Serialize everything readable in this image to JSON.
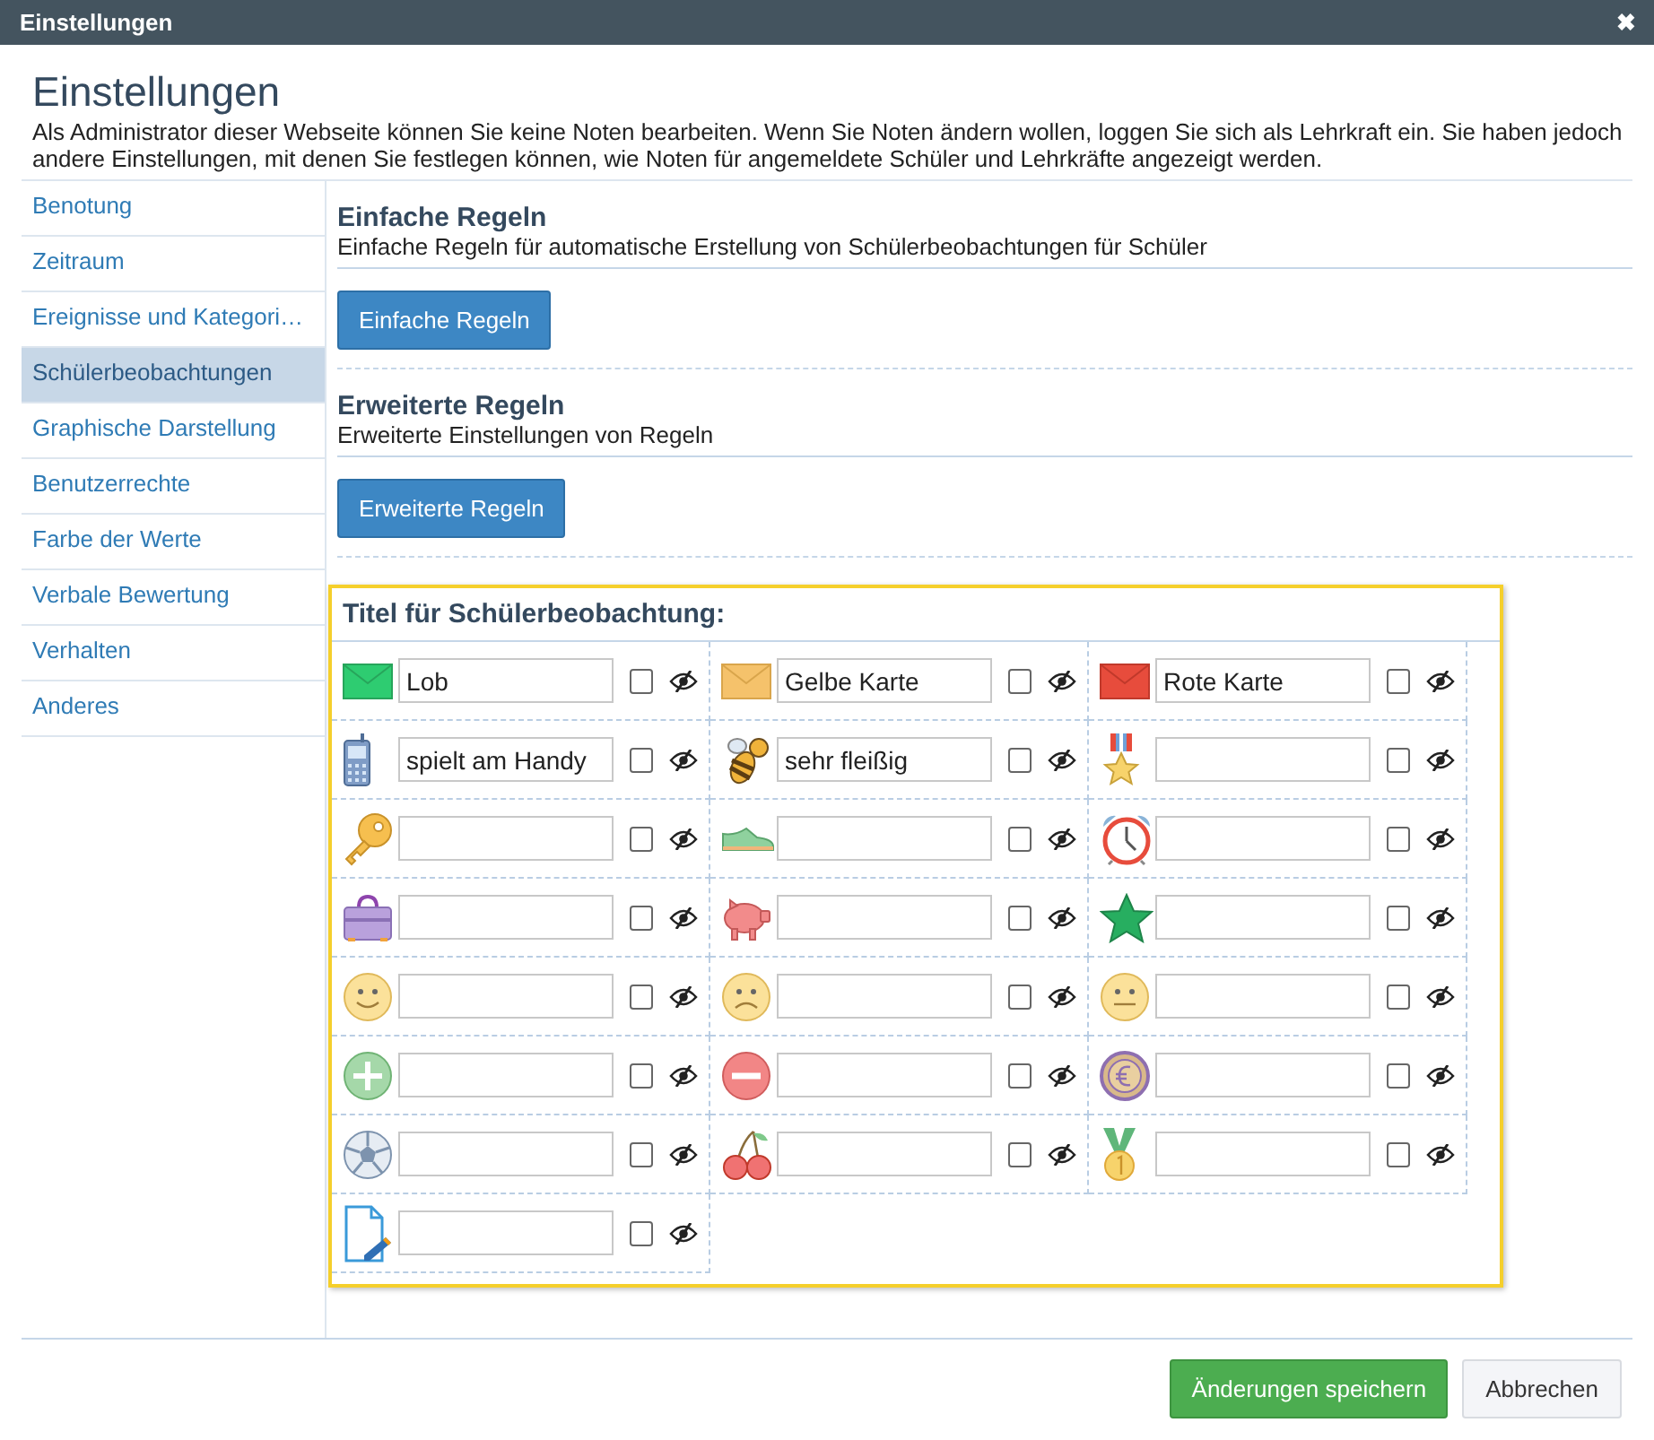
{
  "window": {
    "title": "Einstellungen",
    "close": "✖"
  },
  "header": {
    "title": "Einstellungen",
    "description": "Als Administrator dieser Webseite können Sie keine Noten bearbeiten. Wenn Sie Noten ändern wollen, loggen Sie sich als Lehrkraft ein. Sie haben jedoch andere Einstellungen, mit denen Sie festlegen können, wie Noten für angemeldete Schüler und Lehrkräfte angezeigt werden."
  },
  "sidebar": {
    "items": [
      {
        "label": "Benotung",
        "selected": false
      },
      {
        "label": "Zeitraum",
        "selected": false
      },
      {
        "label": "Ereignisse und Kategori…",
        "selected": false
      },
      {
        "label": "Schülerbeobachtungen",
        "selected": true
      },
      {
        "label": "Graphische Darstellung",
        "selected": false
      },
      {
        "label": "Benutzerrechte",
        "selected": false
      },
      {
        "label": "Farbe der Werte",
        "selected": false
      },
      {
        "label": "Verbale Bewertung",
        "selected": false
      },
      {
        "label": "Verhalten",
        "selected": false
      },
      {
        "label": "Anderes",
        "selected": false
      }
    ]
  },
  "sections": [
    {
      "title": "Einfache Regeln",
      "subtitle": "Einfache Regeln für automatische Erstellung von Schülerbeobachtungen für Schüler",
      "button": "Einfache Regeln"
    },
    {
      "title": "Erweiterte Regeln",
      "subtitle": "Erweiterte Einstellungen von Regeln",
      "button": "Erweiterte Regeln"
    }
  ],
  "observations_title": "Titel für Schülerbeobachtung:",
  "observations": [
    {
      "value": "Lob",
      "checked": false
    },
    {
      "value": "Gelbe Karte",
      "checked": false
    },
    {
      "value": "Rote Karte",
      "checked": false
    },
    {
      "value": "spielt am Handy",
      "checked": false
    },
    {
      "value": "sehr fleißig",
      "checked": false
    },
    {
      "checked": false
    },
    {
      "checked": false
    },
    {
      "checked": false
    },
    {
      "checked": false
    },
    {
      "checked": false
    },
    {
      "checked": false
    },
    {
      "checked": false
    },
    {
      "checked": false
    },
    {
      "checked": false
    },
    {
      "checked": false
    },
    {
      "checked": false
    },
    {
      "checked": false
    },
    {
      "checked": false
    },
    {
      "checked": false
    },
    {
      "checked": false
    },
    {
      "checked": false
    },
    {
      "checked": false
    }
  ],
  "footer": {
    "save": "Änderungen speichern",
    "cancel": "Abbrechen"
  }
}
